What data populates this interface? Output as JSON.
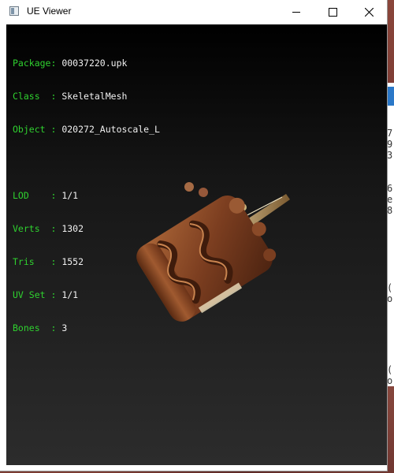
{
  "window": {
    "title": "UE Viewer"
  },
  "info": {
    "object_rows": [
      {
        "label": "Package:",
        "value": "00037220.upk"
      },
      {
        "label": "Class  :",
        "value": "SkeletalMesh"
      },
      {
        "label": "Object :",
        "value": "020272_Autoscale_L"
      }
    ],
    "mesh_rows": [
      {
        "label": "LOD    :",
        "value": "1/1"
      },
      {
        "label": "Verts  :",
        "value": "1302"
      },
      {
        "label": "Tris   :",
        "value": "1552"
      },
      {
        "label": "UV Set :",
        "value": "1/1"
      },
      {
        "label": "Bones  :",
        "value": "3"
      }
    ]
  },
  "colors": {
    "label_green": "#2fd12f",
    "value_white": "#f0f0f0",
    "mesh_brown": "#8a4a26"
  },
  "background_peek": [
    "7",
    "9",
    "3",
    "",
    "6",
    "e",
    "8",
    "",
    "(",
    "",
    "o",
    "(",
    "o"
  ]
}
